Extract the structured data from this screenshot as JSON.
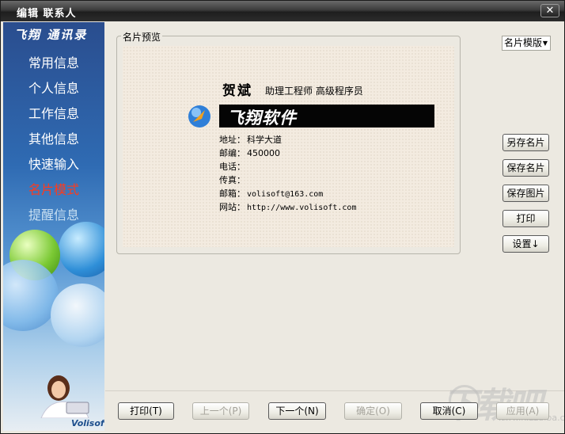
{
  "window": {
    "title": "编辑 联系人",
    "close_glyph": "✕"
  },
  "sidebar": {
    "logo_text": "飞翔 通讯录",
    "items": [
      {
        "label": "常用信息",
        "state": "normal"
      },
      {
        "label": "个人信息",
        "state": "normal"
      },
      {
        "label": "工作信息",
        "state": "normal"
      },
      {
        "label": "其他信息",
        "state": "normal"
      },
      {
        "label": "快速输入",
        "state": "normal"
      },
      {
        "label": "名片模式",
        "state": "active"
      },
      {
        "label": "提醒信息",
        "state": "dim"
      }
    ],
    "brand": "Volisoft"
  },
  "preview": {
    "group_label": "名片预览",
    "card": {
      "name": "贺斌",
      "titles": "助理工程师 高级程序员",
      "company": "飞翔软件",
      "lines": [
        {
          "label": "地址：",
          "value": "科学大道"
        },
        {
          "label": "邮编：",
          "value": "450000"
        },
        {
          "label": "电话：",
          "value": ""
        },
        {
          "label": "传真：",
          "value": ""
        },
        {
          "label": "邮箱：",
          "value": "volisoft@163.com"
        },
        {
          "label": "网站：",
          "value": "http://www.volisoft.com"
        }
      ]
    }
  },
  "side_panel": {
    "template_select": "名片模版",
    "buttons": {
      "save_as_card": "另存名片",
      "save_card": "保存名片",
      "save_image": "保存图片",
      "print": "打印",
      "settings": "设置↓"
    }
  },
  "footer": {
    "print": "打印(T)",
    "prev": "上一个(P)",
    "next": "下一个(N)",
    "ok": "确定(O)",
    "cancel": "取消(C)",
    "apply": "应用(A)"
  },
  "watermark": {
    "text": "下载吧",
    "url": "www.xiazaiba.com"
  },
  "colors": {
    "active_nav": "#ff3a1c",
    "sidebar_top": "#2a4d8e",
    "card_bg": "#f3ebe0"
  }
}
